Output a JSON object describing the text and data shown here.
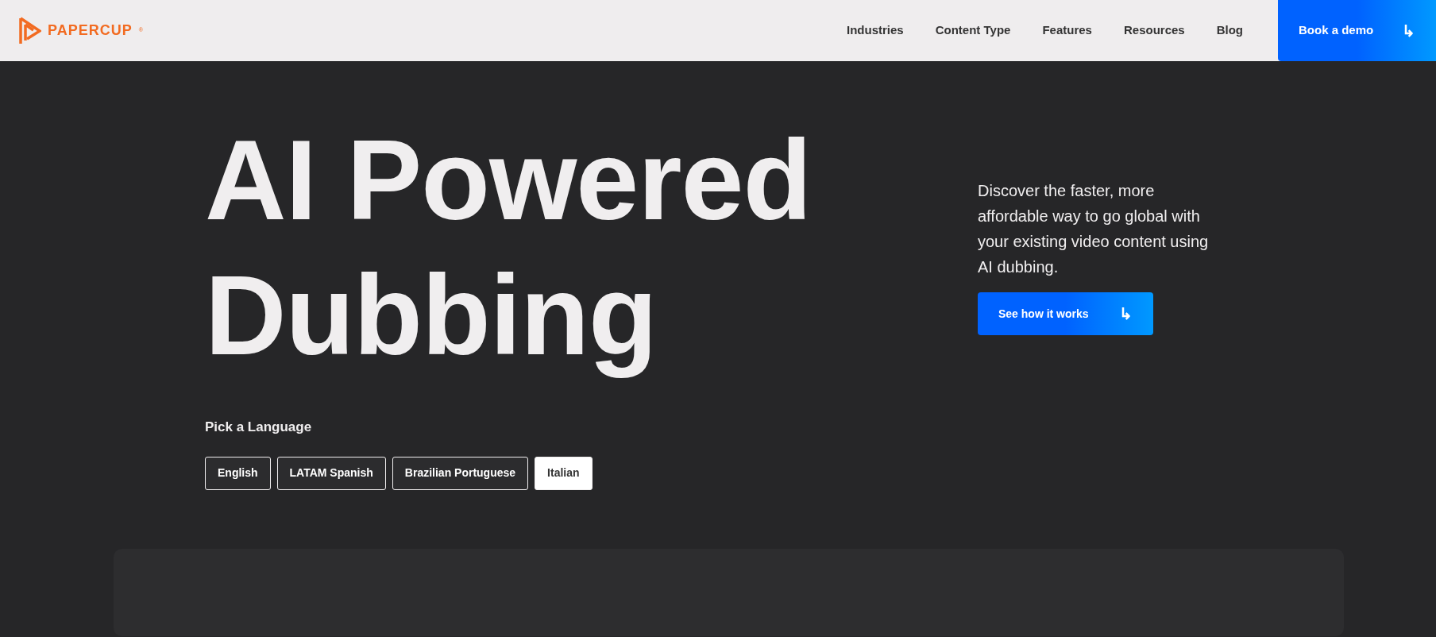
{
  "brand": {
    "name": "PAPERCUP",
    "mark": "®"
  },
  "nav": {
    "items": [
      "Industries",
      "Content Type",
      "Features",
      "Resources",
      "Blog"
    ],
    "cta": "Book a demo",
    "cta_icon": "↳"
  },
  "hero": {
    "title_lines": [
      "AI Powered",
      "Dubbing"
    ],
    "description": "Discover the faster, more affordable way to go global with your existing video content using AI dubbing.",
    "button": "See how it works",
    "button_icon": "↳"
  },
  "languages": {
    "label": "Pick a Language",
    "options": [
      {
        "label": "English",
        "selected": false
      },
      {
        "label": "LATAM Spanish",
        "selected": false
      },
      {
        "label": "Brazilian Portuguese",
        "selected": false
      },
      {
        "label": "Italian",
        "selected": true
      }
    ]
  }
}
